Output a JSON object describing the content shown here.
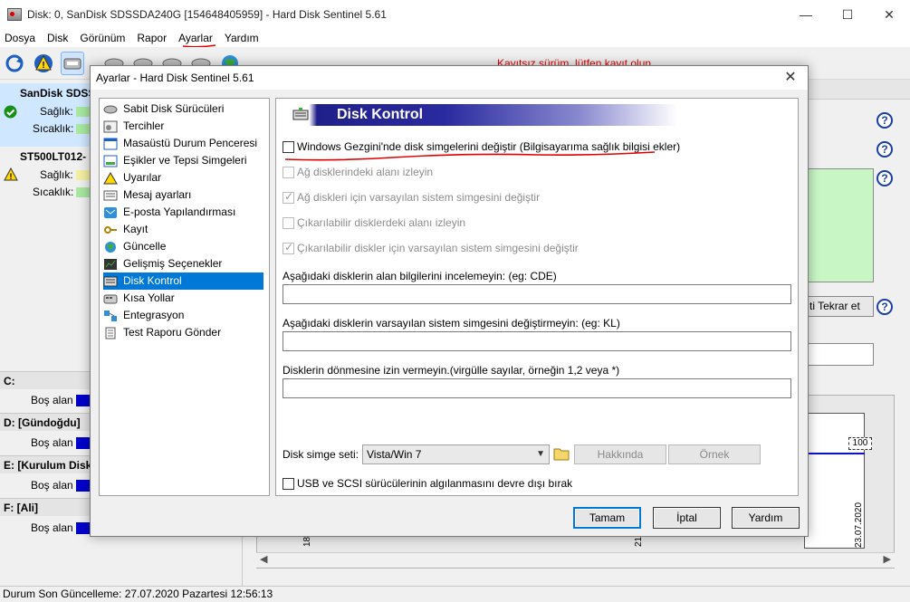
{
  "main_window": {
    "title": "Disk: 0, SanDisk SDSSDA240G [154648405959]  -  Hard Disk Sentinel 5.61",
    "controls": {
      "minimize": "—",
      "maximize": "☐",
      "close": "✕"
    }
  },
  "menubar": [
    "Dosya",
    "Disk",
    "Görünüm",
    "Rapor",
    "Ayarlar",
    "Yardım"
  ],
  "toolbar": {
    "icons": [
      "refresh-icon",
      "warning-icon",
      "disk-icon",
      "hdd-icon",
      "hdd-icon",
      "hdd-icon",
      "hdd-icon",
      "globe-icon",
      "report-icon",
      "mail-icon",
      "globe-icon",
      "chart-icon",
      "speaker-icon",
      "help-icon",
      "info-icon"
    ],
    "registration_warning": "Kayıtsız sürüm, lütfen kayıt olun"
  },
  "left_panel": {
    "disks": [
      {
        "name": "SanDisk SDSS",
        "health_label": "Sağlık:",
        "temp_label": "Sıcaklık:",
        "status_icon": "check-icon"
      },
      {
        "name": "ST500LT012-",
        "health_label": "Sağlık:",
        "temp_label": "Sıcaklık:",
        "status_icon": "warning-icon"
      }
    ],
    "partitions": [
      {
        "name": "C:",
        "free_label": "Boş alan"
      },
      {
        "name": "D: [Gündoğdu]",
        "free_label": "Boş alan"
      },
      {
        "name": "E: [Kurulum Diski]",
        "free_label": "Boş alan"
      },
      {
        "name": "F: [Ali]",
        "free_label": "Boş alan"
      }
    ]
  },
  "right_panel": {
    "retry_button": "ti Tekrar et",
    "graph": {
      "value_label": "100",
      "date_right": "23.07.2020",
      "date_mid": "21",
      "date_left": "18"
    }
  },
  "statusbar": "Durum Son Güncelleme: 27.07.2020 Pazartesi 12:56:13",
  "dialog": {
    "title": "Ayarlar  -  Hard Disk Sentinel 5.61",
    "close": "✕",
    "nav_items": [
      {
        "label": "Sabit Disk Sürücüleri",
        "icon": "hdd-icon"
      },
      {
        "label": "Tercihler",
        "icon": "gear-icon"
      },
      {
        "label": "Masaüstü Durum Penceresi",
        "icon": "window-icon"
      },
      {
        "label": "Eşikler ve Tepsi Simgeleri",
        "icon": "tray-icon"
      },
      {
        "label": "Uyarılar",
        "icon": "warning-icon"
      },
      {
        "label": "Mesaj ayarları",
        "icon": "message-icon"
      },
      {
        "label": "E-posta Yapılandırması",
        "icon": "mail-icon"
      },
      {
        "label": "Kayıt",
        "icon": "key-icon"
      },
      {
        "label": "Güncelle",
        "icon": "globe-icon"
      },
      {
        "label": "Gelişmiş Seçenekler",
        "icon": "chip-icon"
      },
      {
        "label": "Disk Kontrol",
        "icon": "disk-control-icon",
        "selected": true
      },
      {
        "label": "Kısa Yollar",
        "icon": "shortcut-icon"
      },
      {
        "label": "Entegrasyon",
        "icon": "integration-icon"
      },
      {
        "label": "Test Raporu Gönder",
        "icon": "report-icon"
      }
    ],
    "content": {
      "header": "Disk Kontrol",
      "checkboxes": [
        {
          "label": "Windows Gezgini'nde disk simgelerini değiştir (Bilgisayarıma sağlık bilgisi ekler)",
          "checked": false,
          "enabled": true
        },
        {
          "label": "Ağ disklerindeki alanı izleyin",
          "checked": false,
          "enabled": false
        },
        {
          "label": "Ağ diskleri için varsayılan sistem simgesini değiştir",
          "checked": true,
          "enabled": false
        },
        {
          "label": "Çıkarılabilir disklerdeki alanı izleyin",
          "checked": false,
          "enabled": false
        },
        {
          "label": "Çıkarılabilir diskler için varsayılan sistem simgesini değiştir",
          "checked": true,
          "enabled": false
        }
      ],
      "fields": [
        {
          "label": "Aşağıdaki disklerin alan bilgilerini incelemeyin: (eg: CDE)",
          "value": ""
        },
        {
          "label": "Aşağıdaki disklerin varsayılan sistem simgesini değiştirmeyin: (eg: KL)",
          "value": ""
        },
        {
          "label": "Disklerin dönmesine izin vermeyin.(virgülle sayılar, örneğin 1,2 veya *)",
          "value": ""
        }
      ],
      "icon_set_label": "Disk simge seti:",
      "icon_set_value": "Vista/Win 7",
      "about_button": "Hakkında",
      "example_button": "Örnek",
      "usb_checkbox": {
        "label": "USB ve SCSI sürücülerinin algılanmasını devre dışı bırak",
        "checked": false
      }
    },
    "buttons": {
      "ok": "Tamam",
      "cancel": "İptal",
      "help": "Yardım"
    }
  },
  "colors": {
    "selection": "#0078d7",
    "header_band": "#2a2aa0",
    "warning": "#e00000",
    "annotation": "#e00000"
  }
}
